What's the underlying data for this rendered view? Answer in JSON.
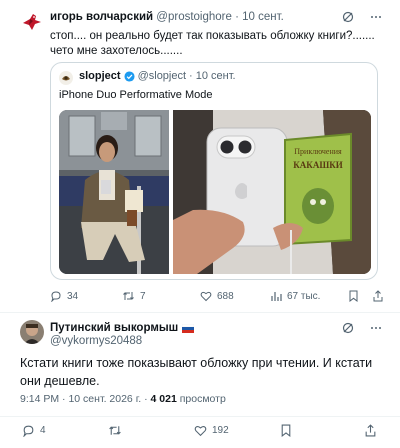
{
  "tweet1": {
    "author": "игорь волчарский",
    "handle": "@prostoighore",
    "dot": "·",
    "date": "10 сент.",
    "text": "стоп.... он реально будет так показывать обложку книги?....... чето мне захотелось.......",
    "quote": {
      "author": "slopject",
      "handle": "@slopject",
      "dot": "·",
      "date": "10 сент.",
      "text": "iPhone Duo Performative Mode",
      "book_title_line1": "Приключения",
      "book_title_line2": "КАКАШКИ"
    },
    "stats": {
      "replies": "34",
      "retweets": "7",
      "likes": "688",
      "views": "67 тыс."
    }
  },
  "tweet2": {
    "author": "Путинский выкормыш",
    "flag_emoji": "🇷🇺",
    "handle": "@vykormys20488",
    "text": "Кстати книги тоже показывают обложку при чтении. И кстати они дешевле.",
    "time": "9:14 PM",
    "dot": "·",
    "date": "10 сент. 2026 г.",
    "views_count": "4 021",
    "views_label": "просмотр",
    "stats": {
      "replies": "4",
      "likes": "192"
    }
  },
  "colors": {
    "muted": "#536471",
    "border": "#cfd9de",
    "verified": "#1d9bf0",
    "text": "#0f1419"
  },
  "icons": [
    "grok-icon",
    "more-icon",
    "reply-icon",
    "retweet-icon",
    "like-icon",
    "views-icon",
    "bookmark-icon",
    "share-icon",
    "verified-badge-icon"
  ]
}
